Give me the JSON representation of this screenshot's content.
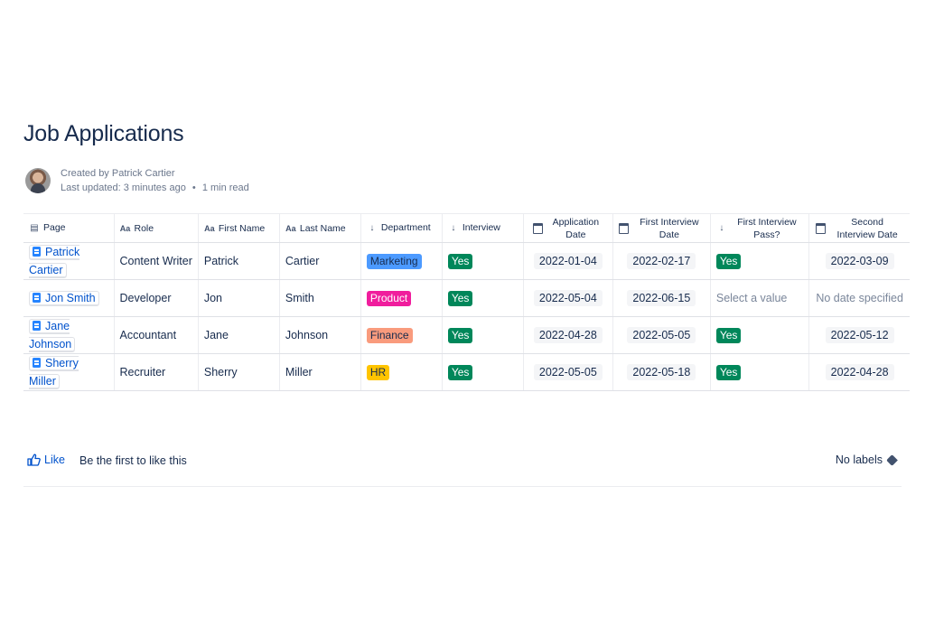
{
  "page": {
    "title": "Job Applications",
    "created_by": "Created by Patrick Cartier",
    "last_updated": "Last updated: 3 minutes ago",
    "read_time": "1 min read"
  },
  "table": {
    "headers": [
      {
        "label": "Page",
        "icon": "page-icon"
      },
      {
        "label": "Role",
        "icon": "text-field-icon"
      },
      {
        "label": "First Name",
        "icon": "text-field-icon"
      },
      {
        "label": "Last Name",
        "icon": "text-field-icon"
      },
      {
        "label": "Department",
        "icon": "select-arrow-icon"
      },
      {
        "label": "Interview",
        "icon": "select-arrow-icon"
      },
      {
        "label": "Application Date",
        "icon": "calendar-icon"
      },
      {
        "label": "First Interview Date",
        "icon": "calendar-icon"
      },
      {
        "label": "First Interview Pass?",
        "icon": "select-arrow-icon"
      },
      {
        "label": "Second Interview Date",
        "icon": "calendar-icon"
      }
    ],
    "rows": [
      {
        "page": "Patrick Cartier",
        "role": "Content Writer",
        "first": "Patrick",
        "last": "Cartier",
        "department": "Marketing",
        "interview": "Yes",
        "app_date": "2022-01-04",
        "first_int_date": "2022-02-17",
        "pass": "Yes",
        "second_int_date": "2022-03-09"
      },
      {
        "page": "Jon Smith",
        "role": "Developer",
        "first": "Jon",
        "last": "Smith",
        "department": "Product",
        "interview": "Yes",
        "app_date": "2022-05-04",
        "first_int_date": "2022-06-15",
        "pass": "Select a value",
        "second_int_date": "No date specified"
      },
      {
        "page": "Jane Johnson",
        "role": "Accountant",
        "first": "Jane",
        "last": "Johnson",
        "department": "Finance",
        "interview": "Yes",
        "app_date": "2022-04-28",
        "first_int_date": "2022-05-05",
        "pass": "Yes",
        "second_int_date": "2022-05-12"
      },
      {
        "page": "Sherry Miller",
        "role": "Recruiter",
        "first": "Sherry",
        "last": "Miller",
        "department": "HR",
        "interview": "Yes",
        "app_date": "2022-05-05",
        "first_int_date": "2022-05-18",
        "pass": "Yes",
        "second_int_date": "2022-04-28"
      }
    ]
  },
  "footer": {
    "like_label": "Like",
    "like_text": "Be the first to like this",
    "labels_text": "No labels"
  },
  "colors": {
    "marketing": "#4c9aff",
    "product": "#f01d9d",
    "finance": "#f99b7d",
    "hr": "#ffc400",
    "yes": "#00875a",
    "link": "#0052cc"
  }
}
